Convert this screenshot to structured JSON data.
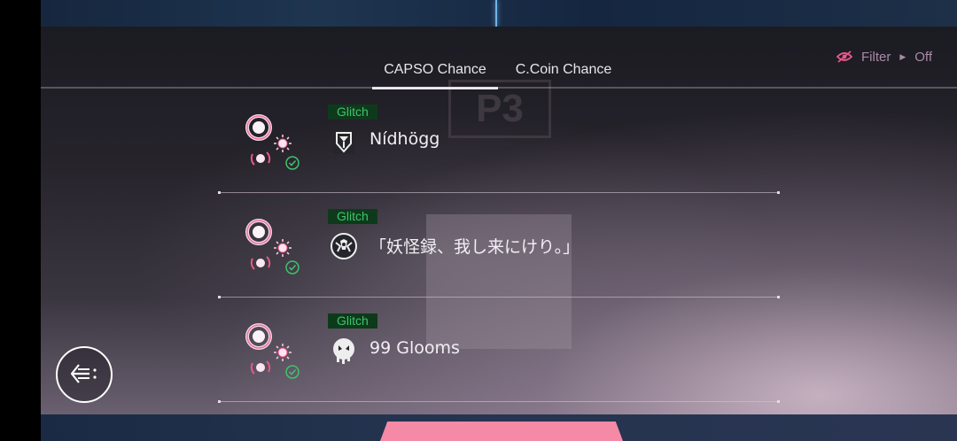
{
  "tabs": [
    {
      "label": "CAPSO Chance",
      "active": true
    },
    {
      "label": "C.Coin Chance",
      "active": false
    }
  ],
  "filter": {
    "label": "Filter",
    "value": "Off",
    "icon": "eye-slash-icon"
  },
  "songs": [
    {
      "difficulty": "Glitch",
      "title": "Nídhögg",
      "icon": "shield-emblem-icon",
      "cleared": true
    },
    {
      "difficulty": "Glitch",
      "title": "「妖怪録、我し来にけり。」",
      "icon": "demon-mask-icon",
      "cleared": true
    },
    {
      "difficulty": "Glitch",
      "title": "99 Glooms",
      "icon": "dripping-skull-icon",
      "cleared": true
    }
  ],
  "back_button": {
    "icon": "back-arrow-icon"
  },
  "colors": {
    "accent_pink": "#e8588a",
    "badge_bg": "#0e3a1c",
    "badge_text": "#3fc36a",
    "check_green": "#3fc36a"
  }
}
